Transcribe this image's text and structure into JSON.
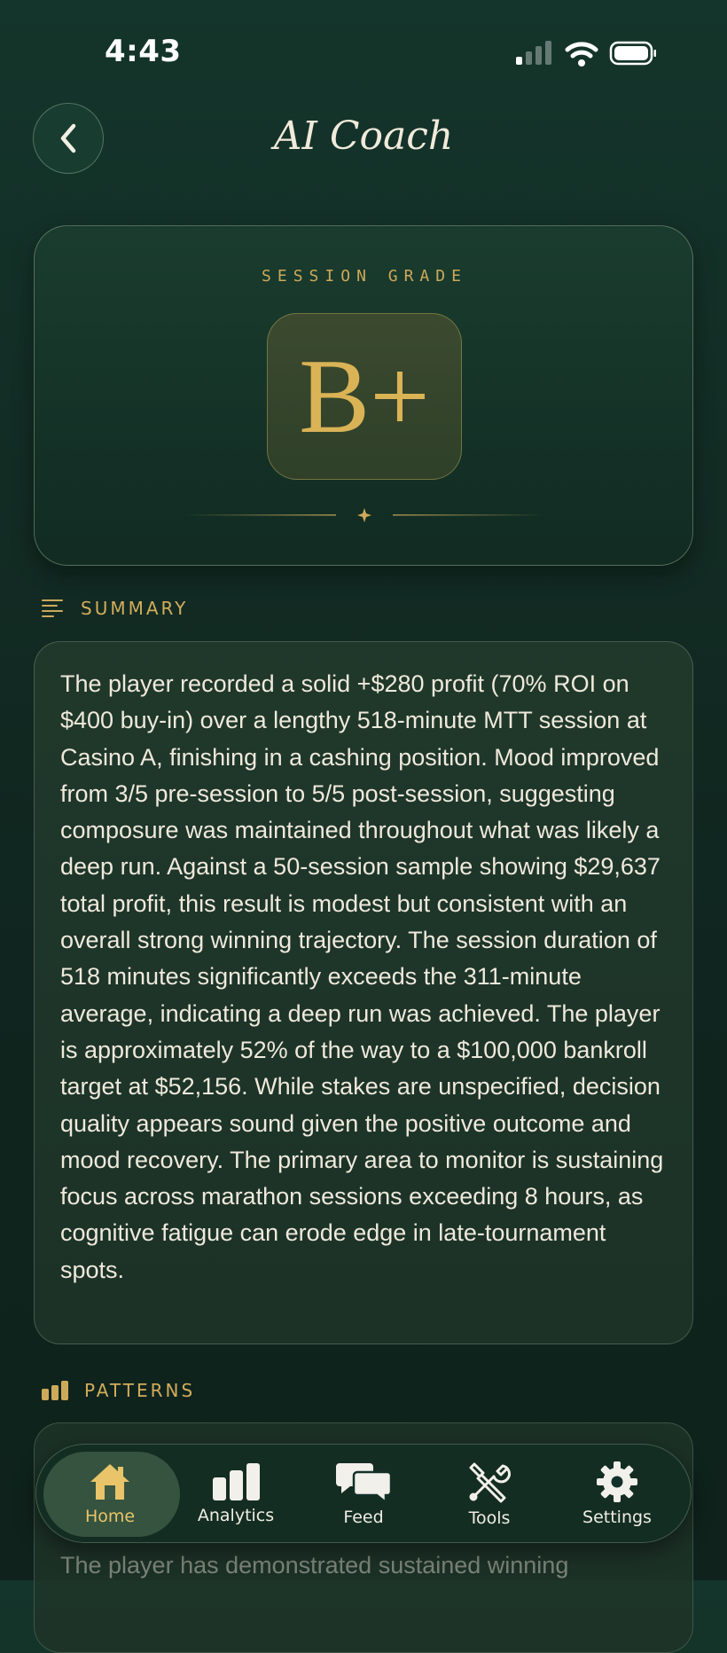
{
  "status_bar": {
    "time": "4:43"
  },
  "header": {
    "title": "AI Coach"
  },
  "grade": {
    "label": "SESSION GRADE",
    "value": "B+"
  },
  "summary": {
    "heading": "SUMMARY",
    "text": "The player recorded a solid +$280 profit (70% ROI on $400 buy-in) over a lengthy 518-minute MTT session at Casino A, finishing in a cashing position. Mood improved from 3/5 pre-session to 5/5 post-session, suggesting composure was maintained throughout what was likely a deep run. Against a 50-session sample showing $29,637 total profit, this result is modest but consistent with an overall strong winning trajectory. The session duration of 518 minutes significantly exceeds the 311-minute average, indicating a deep run was achieved. The player is approximately 52% of the way to a $100,000 bankroll target at $52,156. While stakes are unspecified, decision quality appears sound given the positive outcome and mood recovery. The primary area to monitor is sustaining focus across marathon sessions exceeding 8 hours, as cognitive fatigue can erode edge in late-tournament spots."
  },
  "patterns": {
    "heading": "PATTERNS",
    "text": "The player has demonstrated sustained winning"
  },
  "tab_bar": {
    "items": [
      {
        "label": "Home",
        "icon": "home-icon",
        "active": true
      },
      {
        "label": "Analytics",
        "icon": "bar-chart-icon",
        "active": false
      },
      {
        "label": "Feed",
        "icon": "chat-bubbles-icon",
        "active": false
      },
      {
        "label": "Tools",
        "icon": "tools-icon",
        "active": false
      },
      {
        "label": "Settings",
        "icon": "gear-icon",
        "active": false
      }
    ]
  },
  "colors": {
    "accent_gold": "#d9b355",
    "background": "#122c24",
    "active_tab": "#e9c46a"
  }
}
